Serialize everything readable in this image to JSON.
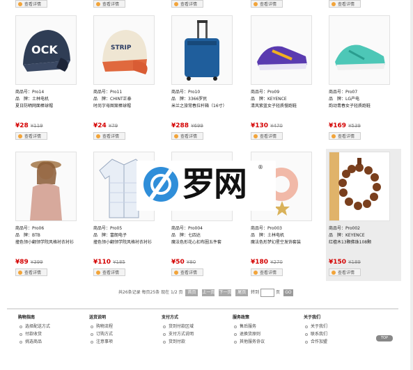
{
  "detail_label": "查看详情",
  "row1": [
    {
      "sku": "商品号：Pro14",
      "brand": "品　牌：土林电机",
      "name": "夏日防晒网面棒球帽",
      "price": "¥28",
      "old": "¥119"
    },
    {
      "sku": "商品号：Pro11",
      "brand": "品　牌：CHINT正泰",
      "name": "时尚字母图案棒球帽",
      "price": "¥24",
      "old": "¥79"
    },
    {
      "sku": "商品号：Pro10",
      "brand": "品　牌：3366罗民",
      "name": "米兰之旅常春拉杆箱（16寸）",
      "price": "¥288",
      "old": "¥699"
    },
    {
      "sku": "商品号：Pro09",
      "brand": "品　牌：KEYENCE",
      "name": "清风紫蓝女子轻质慢跑鞋",
      "price": "¥130",
      "old": "¥470"
    },
    {
      "sku": "商品号：Pro07",
      "brand": "品　牌：LG产电",
      "name": "韵动青春女子轻质跑鞋",
      "price": "¥169",
      "old": "¥539"
    }
  ],
  "row2": [
    {
      "sku": "商品号：Pro06",
      "brand": "品　牌：BTB",
      "name": "撞色领小翻领学院风格衬衣衬衫",
      "price": "¥89",
      "old": "¥399"
    },
    {
      "sku": "商品号：Pro05",
      "brand": "品　牌：富朗电子",
      "name": "撞色领小翻领学院风格衬衣衬衫",
      "price": "¥110",
      "old": "¥185"
    },
    {
      "sku": "商品号：Pro004",
      "brand": "品　牌：七四达",
      "name": "魔法色形花心扣布圈五件套",
      "price": "¥50",
      "old": "¥80"
    },
    {
      "sku": "商品号：Pro003",
      "brand": "品　牌：土林电机",
      "name": "魔法色形梦幻星空发饰套装",
      "price": "¥180",
      "old": "¥270"
    },
    {
      "sku": "商品号：Pro002",
      "brand": "品　牌：KEYENCE",
      "name": "红檀木13颗佛珠108颗",
      "price": "¥150",
      "old": "¥189"
    }
  ],
  "pager": {
    "summary": "共26条记录 每页25条 现在 1/2 页",
    "first": "首页",
    "prev": "上一页",
    "next": "下一页",
    "last": "尾页",
    "jump": "转到",
    "unit": "页",
    "go": "GO"
  },
  "footer": {
    "cols": [
      {
        "title": "购物指南",
        "items": [
          "选择配送方式",
          "付款收货",
          "挑选商品"
        ]
      },
      {
        "title": "送货说明",
        "items": [
          "购物流程",
          "订购方式",
          "注意事项"
        ]
      },
      {
        "title": "支付方式",
        "items": [
          "货到付款区域",
          "支付方式说明",
          "货到付款"
        ]
      },
      {
        "title": "服务政策",
        "items": [
          "售后服务",
          "退换货原则",
          "其他服务协议"
        ]
      },
      {
        "title": "关于我们",
        "items": [
          "关于我们",
          "联系我们",
          "合作加盟"
        ]
      }
    ],
    "totop": "TOP"
  },
  "watermark": {
    "text": "罗网",
    "reg": "®"
  }
}
